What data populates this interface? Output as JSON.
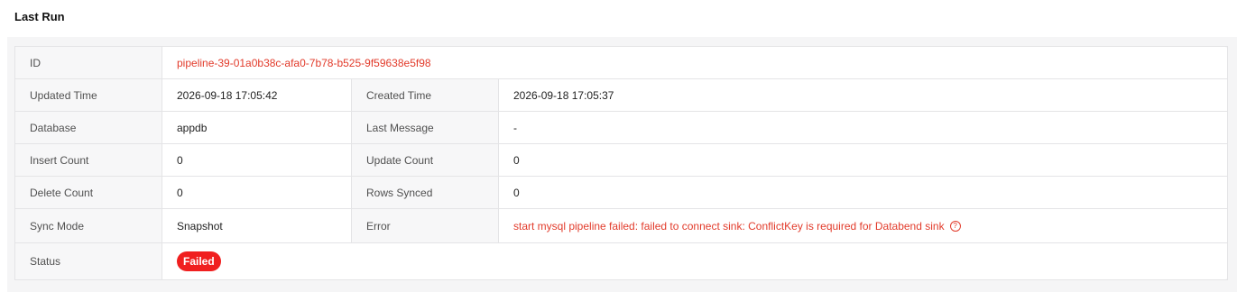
{
  "section": {
    "title": "Last Run"
  },
  "run": {
    "id_label": "ID",
    "id_value": "pipeline-39-01a0b38c-afa0-7b78-b525-9f59638e5f98",
    "updated_label": "Updated Time",
    "updated_value": "2026-09-18 17:05:42",
    "created_label": "Created Time",
    "created_value": "2026-09-18 17:05:37",
    "database_label": "Database",
    "database_value": "appdb",
    "last_message_label": "Last Message",
    "last_message_value": "-",
    "insert_label": "Insert Count",
    "insert_value": "0",
    "update_label": "Update Count",
    "update_value": "0",
    "delete_label": "Delete Count",
    "delete_value": "0",
    "rows_synced_label": "Rows Synced",
    "rows_synced_value": "0",
    "sync_mode_label": "Sync Mode",
    "sync_mode_value": "Snapshot",
    "error_label": "Error",
    "error_value": "start mysql pipeline failed: failed to connect sink: ConflictKey is required for Databend sink",
    "error_help_icon": "?",
    "status_label": "Status",
    "status_value": "Failed"
  },
  "colors": {
    "accent": "#e23b2b",
    "failed_badge": "#f01f1f",
    "label_bg": "#f7f7f8",
    "border": "#e4e4e6"
  },
  "icons": {
    "error_help": "question-circle-icon"
  }
}
